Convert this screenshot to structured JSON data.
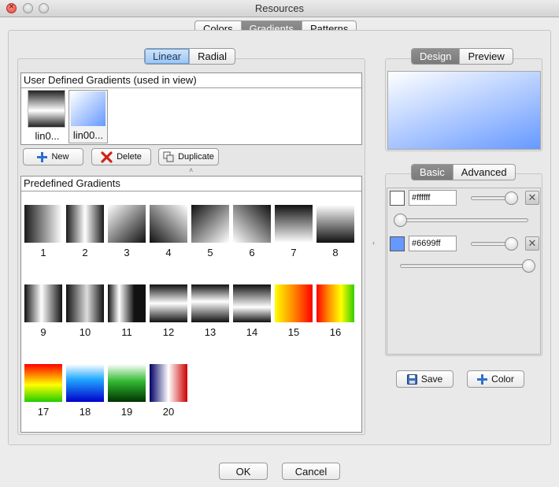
{
  "window": {
    "title": "Resources"
  },
  "main_tabs": [
    {
      "label": "Colors",
      "selected": false
    },
    {
      "label": "Gradients",
      "selected": true
    },
    {
      "label": "Patterns",
      "selected": false
    }
  ],
  "type_tabs": [
    {
      "label": "Linear",
      "selected": true
    },
    {
      "label": "Radial",
      "selected": false
    }
  ],
  "user_section": {
    "title": "User Defined Gradients (used in view)",
    "items": [
      {
        "label": "lin0...",
        "css": "linear-gradient(to bottom, #222 0%, #fff 55%, #222 100%)"
      },
      {
        "label": "lin00...",
        "css": "linear-gradient(135deg, #ffffff 0%, #6699ff 100%)"
      }
    ]
  },
  "actions": {
    "new": "New",
    "delete": "Delete",
    "duplicate": "Duplicate"
  },
  "predefined_section": {
    "title": "Predefined Gradients",
    "items": [
      {
        "label": "1",
        "css": "linear-gradient(to right, #1a1a1a, #ffffff)"
      },
      {
        "label": "2",
        "css": "linear-gradient(to right, #1a1a1a, #ffffff 50%, #1a1a1a)"
      },
      {
        "label": "3",
        "css": "linear-gradient(135deg, #ffffff, #111111)"
      },
      {
        "label": "4",
        "css": "linear-gradient(45deg, #111111, #ffffff)"
      },
      {
        "label": "5",
        "css": "linear-gradient(135deg, #111111, #ffffff)"
      },
      {
        "label": "6",
        "css": "linear-gradient(45deg, #ffffff, #111111)"
      },
      {
        "label": "7",
        "css": "linear-gradient(to bottom, #111111, #ffffff)"
      },
      {
        "label": "8",
        "css": "linear-gradient(to bottom, #ffffff, #111111)"
      },
      {
        "label": "9",
        "css": "linear-gradient(to right, #111, #fff 45%, #111)"
      },
      {
        "label": "10",
        "css": "linear-gradient(to right, #111, #ddd 55%, #111)"
      },
      {
        "label": "11",
        "css": "linear-gradient(to right, #111, #fff 30%, #111 70%)"
      },
      {
        "label": "12",
        "css": "linear-gradient(to bottom, #111, #fff 50%, #111)"
      },
      {
        "label": "13",
        "css": "linear-gradient(to bottom, #111, #fff 45%, #111)"
      },
      {
        "label": "14",
        "css": "linear-gradient(to bottom, #111, #fff 60%, #111)"
      },
      {
        "label": "15",
        "css": "linear-gradient(to right, #ffff00, #ff8800 50%, #ff0000)"
      },
      {
        "label": "16",
        "css": "linear-gradient(to right, #ff0000, #ff9900 35%, #ffff00 65%, #33cc00)"
      },
      {
        "label": "17",
        "css": "linear-gradient(to bottom, #ff0000, #ffff00 55%, #22cc00)"
      },
      {
        "label": "18",
        "css": "linear-gradient(to bottom, #ffffff, #22aaff 40%, #0000cc)"
      },
      {
        "label": "19",
        "css": "linear-gradient(to bottom, #ffffff, #33bb33 45%, #003300)"
      },
      {
        "label": "20",
        "css": "linear-gradient(to right, #000066, #ffffff 50%, #cc0000)"
      }
    ]
  },
  "design_tabs": [
    {
      "label": "Design",
      "selected": true
    },
    {
      "label": "Preview",
      "selected": false
    }
  ],
  "preview_css": "linear-gradient(160deg, #ffffff 0%, #6699ff 100%)",
  "mode_tabs": [
    {
      "label": "Basic",
      "selected": true
    },
    {
      "label": "Advanced",
      "selected": false
    }
  ],
  "stops": [
    {
      "hex": "#ffffff",
      "color": "#ffffff"
    },
    {
      "hex": "#6699ff",
      "color": "#6699ff"
    }
  ],
  "right_actions": {
    "save": "Save",
    "color": "Color"
  },
  "footer": {
    "ok": "OK",
    "cancel": "Cancel"
  }
}
